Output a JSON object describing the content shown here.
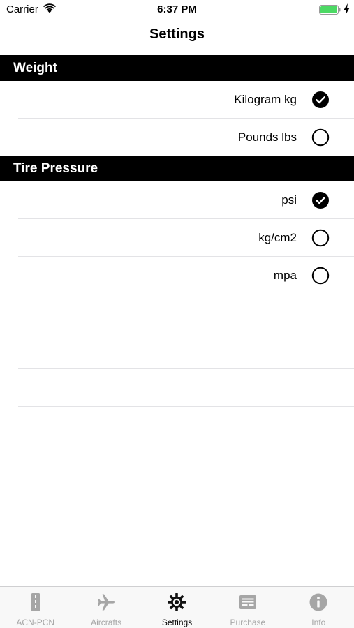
{
  "status_bar": {
    "carrier": "Carrier",
    "time": "6:37 PM"
  },
  "nav": {
    "title": "Settings"
  },
  "sections": [
    {
      "header": "Weight",
      "options": [
        {
          "label": "Kilogram kg",
          "selected": true
        },
        {
          "label": "Pounds lbs",
          "selected": false
        }
      ]
    },
    {
      "header": "Tire Pressure",
      "options": [
        {
          "label": "psi",
          "selected": true
        },
        {
          "label": "kg/cm2",
          "selected": false
        },
        {
          "label": "mpa",
          "selected": false
        }
      ]
    }
  ],
  "tab_bar": {
    "active": "Settings",
    "tabs": [
      {
        "label": "ACN-PCN",
        "icon": "runway-icon"
      },
      {
        "label": "Aircrafts",
        "icon": "airplane-icon"
      },
      {
        "label": "Settings",
        "icon": "gear-icon"
      },
      {
        "label": "Purchase",
        "icon": "receipt-icon"
      },
      {
        "label": "Info",
        "icon": "info-icon"
      }
    ]
  },
  "colors": {
    "section_header_bg": "#000000",
    "active_tab": "#000000",
    "inactive_tab": "#a6a6a6",
    "separator": "#e3e3e6"
  }
}
